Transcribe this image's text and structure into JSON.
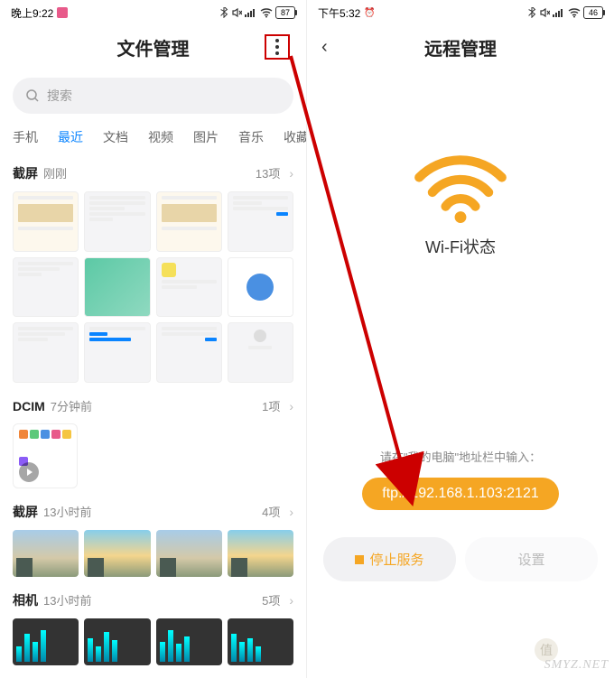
{
  "left": {
    "status": {
      "time": "晚上9:22",
      "battery": "87"
    },
    "title": "文件管理",
    "search_placeholder": "搜索",
    "tabs": [
      "手机",
      "最近",
      "文档",
      "视频",
      "图片",
      "音乐",
      "收藏"
    ],
    "active_tab_index": 1,
    "sections": [
      {
        "name": "截屏",
        "time": "刚刚",
        "count": "13项"
      },
      {
        "name": "DCIM",
        "time": "7分钟前",
        "count": "1项"
      },
      {
        "name": "截屏",
        "time": "13小时前",
        "count": "4项"
      },
      {
        "name": "相机",
        "time": "13小时前",
        "count": "5项"
      }
    ]
  },
  "right": {
    "status": {
      "time": "下午5:32",
      "battery": "46"
    },
    "title": "远程管理",
    "wifi_label": "Wi-Fi状态",
    "instruction": "请在\"我的电脑\"地址栏中输入：",
    "ftp_url": "ftp://192.168.1.103:2121",
    "stop_label": "停止服务",
    "settings_label": "设置",
    "accent_color": "#f5a623"
  },
  "watermark": "SMYZ.NET",
  "watermark_badge": "值"
}
